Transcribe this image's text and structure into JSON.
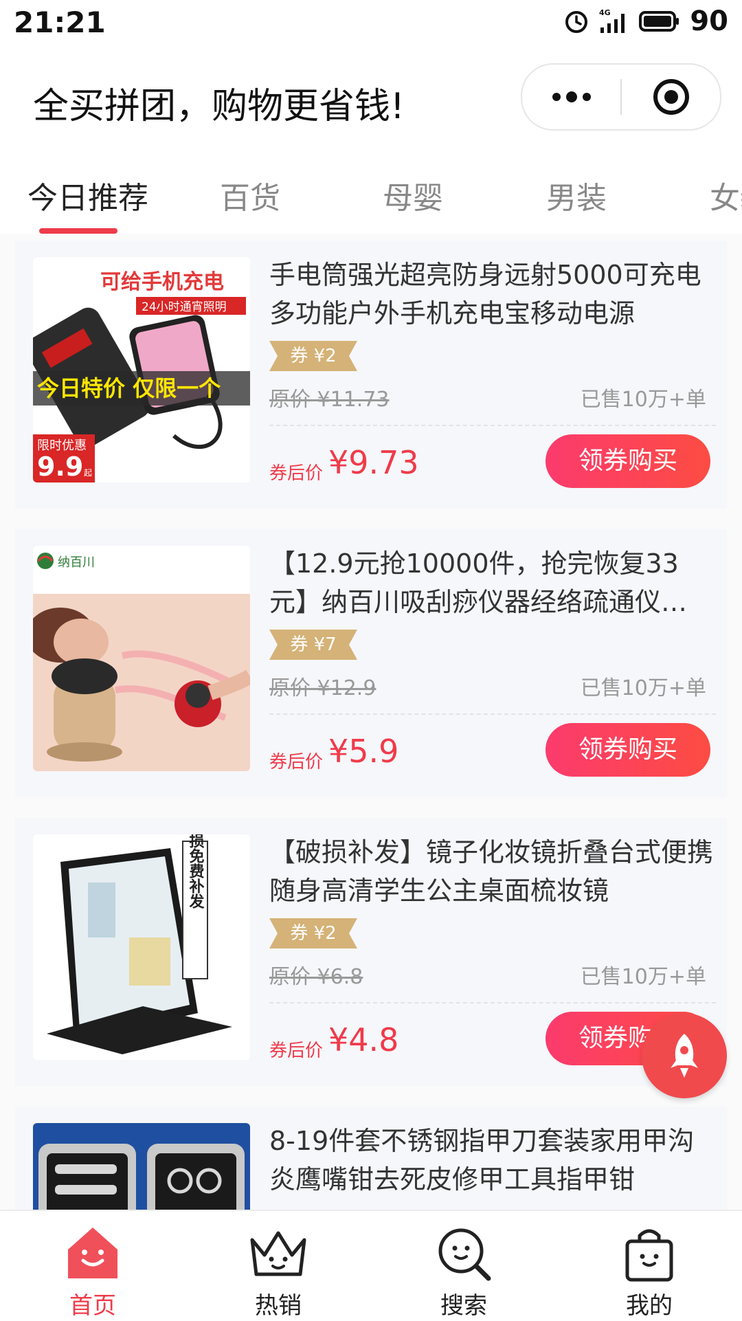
{
  "status_bar": {
    "time": "21:21",
    "network": "4G",
    "battery": "90"
  },
  "header": {
    "title": "全买拼团，购物更省钱!"
  },
  "tabs": [
    {
      "label": "今日推荐",
      "active": true
    },
    {
      "label": "百货",
      "active": false
    },
    {
      "label": "母婴",
      "active": false
    },
    {
      "label": "男装",
      "active": false
    },
    {
      "label": "女装",
      "active": false
    }
  ],
  "products": [
    {
      "title": "手电筒强光超亮防身远射5000可充电多功能户外手机充电宝移动电源",
      "coupon": "券 ¥2",
      "original_price": "原价 ¥11.73",
      "sold": "已售10万+单",
      "after_label": "券后价",
      "after_price": "¥9.73",
      "button": "领券购买",
      "thumb": {
        "headline": "可给手机充电",
        "sub": "24小时通宵照明",
        "promo": "今日特价 仅限一个",
        "badge_top": "限时优惠",
        "badge_price": "9.9",
        "badge_unit": "起"
      }
    },
    {
      "title": "【12.9元抢10000件，抢完恢复33元】纳百川吸刮痧仪器经络疏通仪…",
      "coupon": "券 ¥7",
      "original_price": "原价 ¥12.9",
      "sold": "已售10万+单",
      "after_label": "券后价",
      "after_price": "¥5.9",
      "button": "领券购买",
      "thumb": {
        "brand": "纳百川"
      }
    },
    {
      "title": "【破损补发】镜子化妆镜折叠台式便携随身高清学生公主桌面梳妆镜",
      "coupon": "券 ¥2",
      "original_price": "原价 ¥6.8",
      "sold": "已售10万+单",
      "after_label": "券后价",
      "after_price": "¥4.8",
      "button": "领券购买",
      "thumb": {
        "side_text": "破损免费补发"
      }
    },
    {
      "title": "8-19件套不锈钢指甲刀套装家用甲沟炎鹰嘴钳去死皮修甲工具指甲钳"
    }
  ],
  "bottom_nav": [
    {
      "label": "首页",
      "icon": "home-icon",
      "active": true
    },
    {
      "label": "热销",
      "icon": "crown-icon",
      "active": false
    },
    {
      "label": "搜索",
      "icon": "search-icon",
      "active": false
    },
    {
      "label": "我的",
      "icon": "bag-icon",
      "active": false
    }
  ],
  "colors": {
    "accent": "#ef3b4a",
    "button_start": "#fb3b6d",
    "button_end": "#fd4c43",
    "coupon": "#d5b277"
  }
}
